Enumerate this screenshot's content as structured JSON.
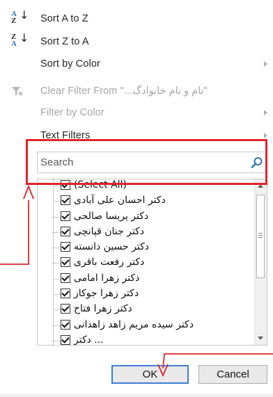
{
  "menu": {
    "sort_az": "Sort A to Z",
    "sort_za": "Sort Z to A",
    "sort_by_color": "Sort by Color",
    "clear_filter": "Clear Filter From \"...نام و نام خانوادگ\"",
    "filter_by_color": "Filter by Color",
    "text_filters": "Text Filters"
  },
  "icons": {
    "sort_az_top": "A",
    "sort_az_bottom": "Z",
    "sort_za_top": "Z",
    "sort_za_bottom": "A",
    "arrow_down": "↓"
  },
  "search": {
    "placeholder": "Search",
    "value": ""
  },
  "list": {
    "items": [
      {
        "label": "(Select All)",
        "checked": true
      },
      {
        "label": "دکتر احسان علی آبادی",
        "checked": true
      },
      {
        "label": "دکتر پریسا صالحی",
        "checked": true
      },
      {
        "label": "دکتر جنان قپانچی",
        "checked": true
      },
      {
        "label": "دکتر حسین دانسته",
        "checked": true
      },
      {
        "label": "دکتر رفعت باقری",
        "checked": true
      },
      {
        "label": "دکتر زهرا امامی",
        "checked": true
      },
      {
        "label": "دکتر زهرا جوکاز",
        "checked": true
      },
      {
        "label": "دکتر زهرا فتاح",
        "checked": true
      },
      {
        "label": "دکتر سیده مریم زاهد زاهدانی",
        "checked": true
      },
      {
        "label": "دکتر ...",
        "checked": true
      }
    ]
  },
  "buttons": {
    "ok": "OK",
    "cancel": "Cancel"
  },
  "colors": {
    "annotation_red": "#e0232c",
    "accent_blue": "#2e75b6"
  }
}
